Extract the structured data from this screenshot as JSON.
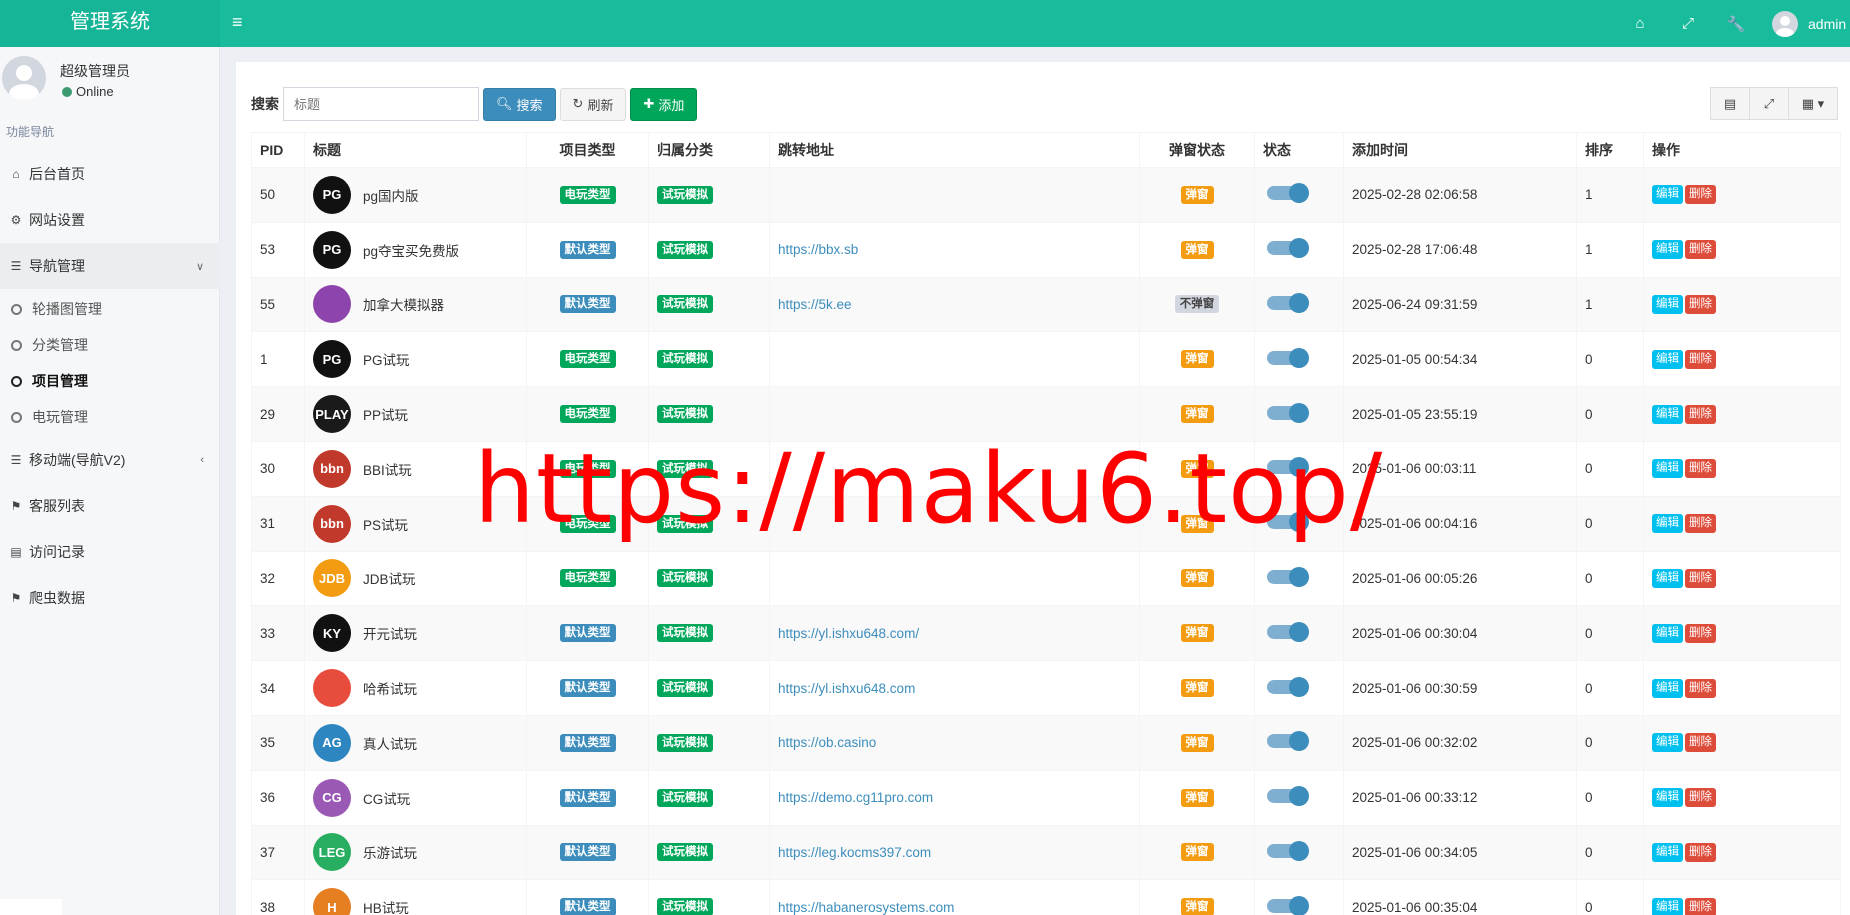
{
  "app": {
    "title": "管理系统"
  },
  "topbar": {
    "user_name": "admin"
  },
  "sidebar": {
    "user_name": "超级管理员",
    "user_status": "Online",
    "nav_header": "功能导航",
    "items": [
      {
        "label": "后台首页",
        "icon": "home-icon"
      },
      {
        "label": "网站设置",
        "icon": "cogs-icon"
      },
      {
        "label": "导航管理",
        "icon": "database-icon"
      },
      {
        "label": "移动端(导航V2)",
        "icon": "database-icon"
      },
      {
        "label": "客服列表",
        "icon": "tags-icon"
      },
      {
        "label": "访问记录",
        "icon": "bar-chart-icon"
      },
      {
        "label": "爬虫数据",
        "icon": "tags-icon"
      }
    ],
    "sub_items": [
      "轮播图管理",
      "分类管理",
      "项目管理",
      "电玩管理"
    ]
  },
  "toolbar": {
    "search_label": "搜索",
    "search_placeholder": "标题",
    "search_button": "搜索",
    "refresh_button": "刷新",
    "add_button": "添加"
  },
  "table": {
    "headers": [
      "PID",
      "标题",
      "项目类型",
      "归属分类",
      "跳转地址",
      "弹窗状态",
      "状态",
      "添加时间",
      "排序",
      "操作"
    ],
    "edit_label": "编辑",
    "delete_label": "删除",
    "rows": [
      {
        "pid": "50",
        "title": "pg国内版",
        "logo": "PG",
        "logo_color": "#111111",
        "type": "电玩类型",
        "category": "试玩模拟",
        "url": "",
        "popup": "弹窗",
        "time": "2025-02-28 02:06:58",
        "sort": "1"
      },
      {
        "pid": "53",
        "title": "pg夺宝买免费版",
        "logo": "PG",
        "logo_color": "#111111",
        "type": "默认类型",
        "category": "试玩模拟",
        "url": "https://bbx.sb",
        "popup": "弹窗",
        "time": "2025-02-28 17:06:48",
        "sort": "1"
      },
      {
        "pid": "55",
        "title": "加拿大模拟器",
        "logo": "",
        "logo_color": "#8e44ad",
        "type": "默认类型",
        "category": "试玩模拟",
        "url": "https://5k.ee",
        "popup": "不弹窗",
        "time": "2025-06-24 09:31:59",
        "sort": "1"
      },
      {
        "pid": "1",
        "title": "PG试玩",
        "logo": "PG",
        "logo_color": "#111111",
        "type": "电玩类型",
        "category": "试玩模拟",
        "url": "",
        "popup": "弹窗",
        "time": "2025-01-05 00:54:34",
        "sort": "0"
      },
      {
        "pid": "29",
        "title": "PP试玩",
        "logo": "PLAY",
        "logo_color": "#1a1a1a",
        "type": "电玩类型",
        "category": "试玩模拟",
        "url": "",
        "popup": "弹窗",
        "time": "2025-01-05 23:55:19",
        "sort": "0"
      },
      {
        "pid": "30",
        "title": "BBI试玩",
        "logo": "bbn",
        "logo_color": "#c0392b",
        "type": "电玩类型",
        "category": "试玩模拟",
        "url": "",
        "popup": "弹窗",
        "time": "2025-01-06 00:03:11",
        "sort": "0"
      },
      {
        "pid": "31",
        "title": "PS试玩",
        "logo": "bbn",
        "logo_color": "#c0392b",
        "type": "电玩类型",
        "category": "试玩模拟",
        "url": "",
        "popup": "弹窗",
        "time": "2025-01-06 00:04:16",
        "sort": "0"
      },
      {
        "pid": "32",
        "title": "JDB试玩",
        "logo": "JDB",
        "logo_color": "#f39c12",
        "type": "电玩类型",
        "category": "试玩模拟",
        "url": "",
        "popup": "弹窗",
        "time": "2025-01-06 00:05:26",
        "sort": "0"
      },
      {
        "pid": "33",
        "title": "开元试玩",
        "logo": "KY",
        "logo_color": "#111111",
        "type": "默认类型",
        "category": "试玩模拟",
        "url": "https://yl.ishxu648.com/",
        "popup": "弹窗",
        "time": "2025-01-06 00:30:04",
        "sort": "0"
      },
      {
        "pid": "34",
        "title": "哈希试玩",
        "logo": "",
        "logo_color": "#e74c3c",
        "type": "默认类型",
        "category": "试玩模拟",
        "url": "https://yl.ishxu648.com",
        "popup": "弹窗",
        "time": "2025-01-06 00:30:59",
        "sort": "0"
      },
      {
        "pid": "35",
        "title": "真人试玩",
        "logo": "AG",
        "logo_color": "#2e86c1",
        "type": "默认类型",
        "category": "试玩模拟",
        "url": "https://ob.casino",
        "popup": "弹窗",
        "time": "2025-01-06 00:32:02",
        "sort": "0"
      },
      {
        "pid": "36",
        "title": "CG试玩",
        "logo": "CG",
        "logo_color": "#9b59b6",
        "type": "默认类型",
        "category": "试玩模拟",
        "url": "https://demo.cg11pro.com",
        "popup": "弹窗",
        "time": "2025-01-06 00:33:12",
        "sort": "0"
      },
      {
        "pid": "37",
        "title": "乐游试玩",
        "logo": "LEG",
        "logo_color": "#27ae60",
        "type": "默认类型",
        "category": "试玩模拟",
        "url": "https://leg.kocms397.com",
        "popup": "弹窗",
        "time": "2025-01-06 00:34:05",
        "sort": "0"
      },
      {
        "pid": "38",
        "title": "HB试玩",
        "logo": "H",
        "logo_color": "#e67e22",
        "type": "默认类型",
        "category": "试玩模拟",
        "url": "https://habanerosystems.com",
        "popup": "弹窗",
        "time": "2025-01-06 00:35:04",
        "sort": "0"
      }
    ]
  },
  "watermark": "https://maku6.top/"
}
